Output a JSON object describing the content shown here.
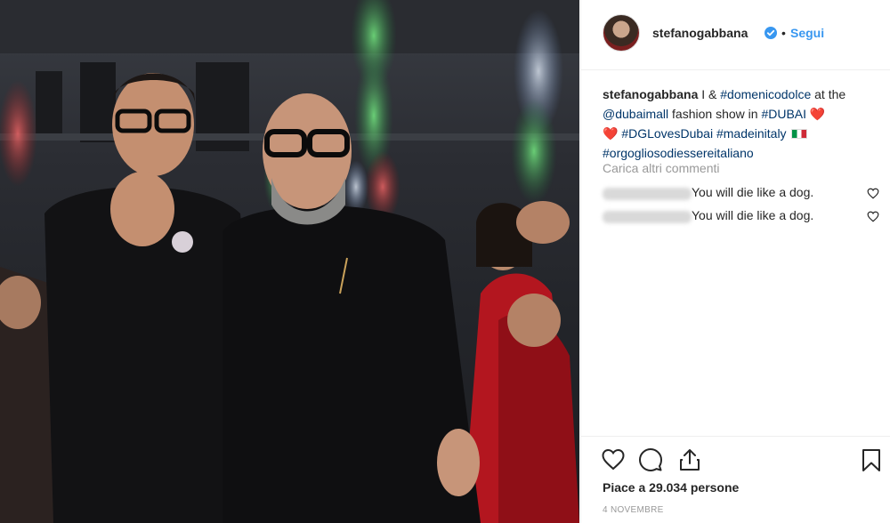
{
  "post": {
    "username": "stefanogabbana",
    "follow_label": "Segui",
    "separator": "•",
    "caption": {
      "username": "stefanogabbana",
      "seg1": " I & ",
      "tag1": "#domenicodolce",
      "seg2": " at the ",
      "mention": "@dubaimall",
      "seg3": " fashion show in ",
      "tag2": "#DUBAI",
      "heart1": " ❤️",
      "heart2": "❤️ ",
      "tag3": "#DGLovesDubai",
      "tag4": "#madeinitaly",
      "tag5": "#orgogliosodiessereitaliano"
    },
    "load_more": "Carica altri commenti",
    "comments": [
      {
        "text": "You will die like a dog."
      },
      {
        "text": "You will die like a dog."
      }
    ],
    "likes": "Piace a 29.034 persone",
    "date": "4 NOVEMBRE"
  },
  "icons": {
    "verified": "verified-badge-icon",
    "heart": "heart-icon",
    "comment": "comment-icon",
    "share": "share-icon",
    "bookmark": "bookmark-icon"
  },
  "colors": {
    "link": "#3897f0",
    "hashtag": "#003569",
    "muted": "#999999",
    "text": "#262626"
  }
}
